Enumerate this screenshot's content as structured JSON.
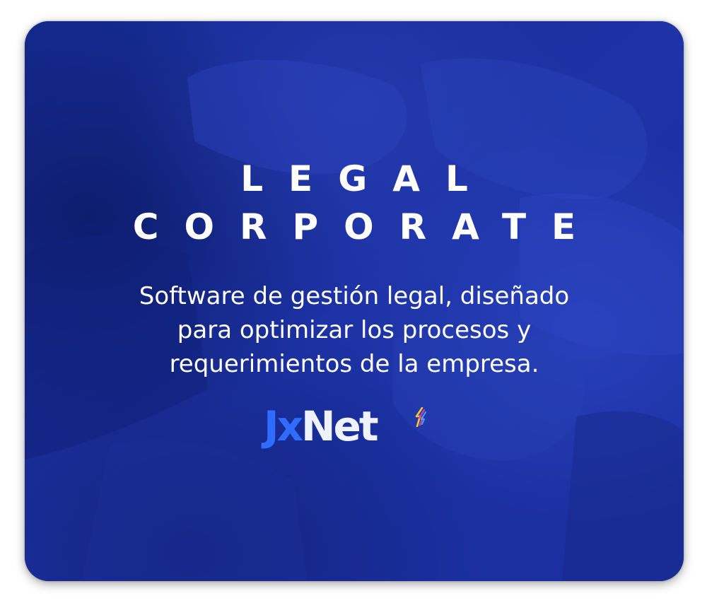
{
  "hero": {
    "title_line1": "LEGAL",
    "title_line2": "CORPORATE",
    "tagline_line1": "Software de gestión legal, diseñado",
    "tagline_line2": "para optimizar los procesos y",
    "tagline_line3": "requerimientos de la empresa."
  },
  "brand": {
    "logo_part1": "Jx",
    "logo_part2": "Net",
    "logo_icon": "lightning-bolt-icon"
  },
  "colors": {
    "overlay_blue": "#1a2f9c",
    "logo_blue": "#2f6cff",
    "text_white": "#ffffff"
  }
}
